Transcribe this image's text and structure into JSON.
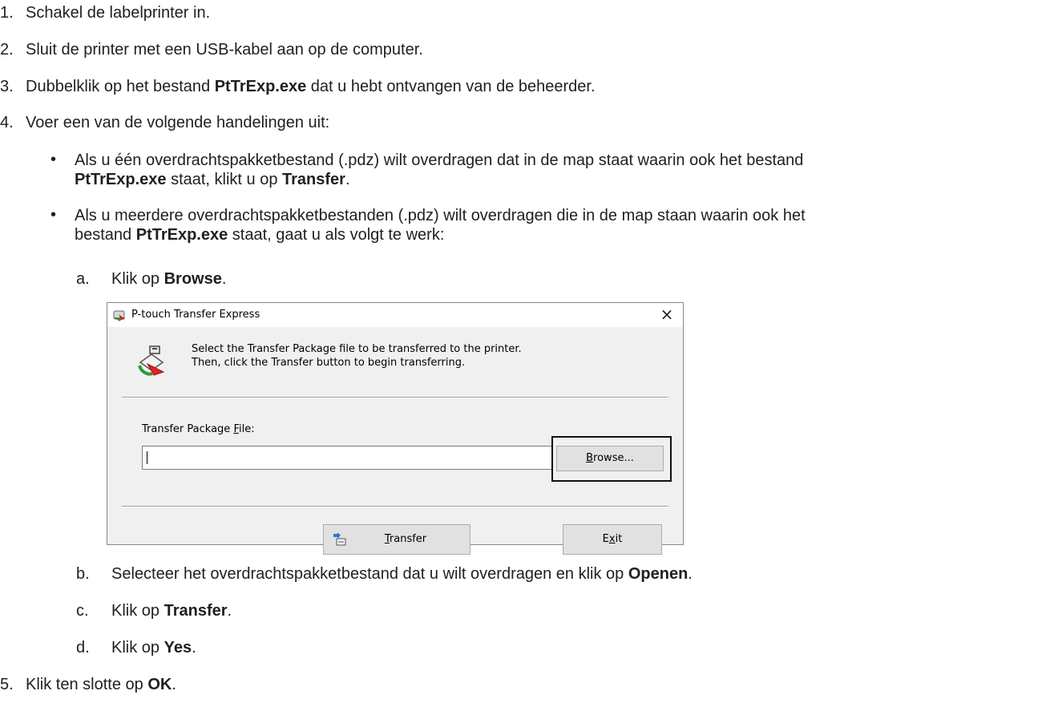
{
  "steps": [
    {
      "num": "1.",
      "text": "Schakel de labelprinter in."
    },
    {
      "num": "2.",
      "text": "Sluit de printer met een USB-kabel aan op de computer."
    },
    {
      "num": "3.",
      "pre": "Dubbelklik op het bestand ",
      "bold": "PtTrExp.exe",
      "post": " dat u hebt ontvangen van de beheerder."
    },
    {
      "num": "4.",
      "text": "Voer een van de volgende handelingen uit:"
    },
    {
      "num": "5.",
      "pre": "Klik ten slotte op ",
      "bold": "OK",
      "post": "."
    }
  ],
  "bullets": [
    {
      "symbol": "•",
      "line1": "Als u één overdrachtspakketbestand (.pdz) wilt overdragen dat in de map staat waarin ook het bestand",
      "line2_bold1": "PtTrExp.exe",
      "line2_mid": " staat, klikt u op ",
      "line2_bold2": "Transfer",
      "line2_end": "."
    },
    {
      "symbol": "•",
      "line1": "Als u meerdere overdrachtspakketbestanden (.pdz) wilt overdragen die in de map staan waarin ook het",
      "line2_pre": "bestand ",
      "line2_bold": "PtTrExp.exe",
      "line2_post": " staat, gaat u als volgt te werk:"
    }
  ],
  "substeps": [
    {
      "letter": "a.",
      "pre": "Klik op ",
      "bold": "Browse",
      "post": "."
    },
    {
      "letter": "b.",
      "pre": "Selecteer het overdrachtspakketbestand dat u wilt overdragen en klik op ",
      "bold": "Openen",
      "post": "."
    },
    {
      "letter": "c.",
      "pre": "Klik op ",
      "bold": "Transfer",
      "post": "."
    },
    {
      "letter": "d.",
      "pre": "Klik op ",
      "bold": "Yes",
      "post": "."
    }
  ],
  "dialog": {
    "title": "P-touch Transfer Express",
    "close": "×",
    "header_line1": "Select the Transfer Package file to be transferred to the printer.",
    "header_line2": "Then, click the Transfer  button to begin transferring.",
    "file_label_pre": "Transfer Package ",
    "file_label_mnemonic": "F",
    "file_label_post": "ile:",
    "file_value": "",
    "browse_mnemonic": "B",
    "browse_rest": "rowse...",
    "transfer_mnemonic": "T",
    "transfer_rest": "ransfer",
    "exit_pre": "E",
    "exit_mnemonic": "x",
    "exit_post": "it"
  }
}
